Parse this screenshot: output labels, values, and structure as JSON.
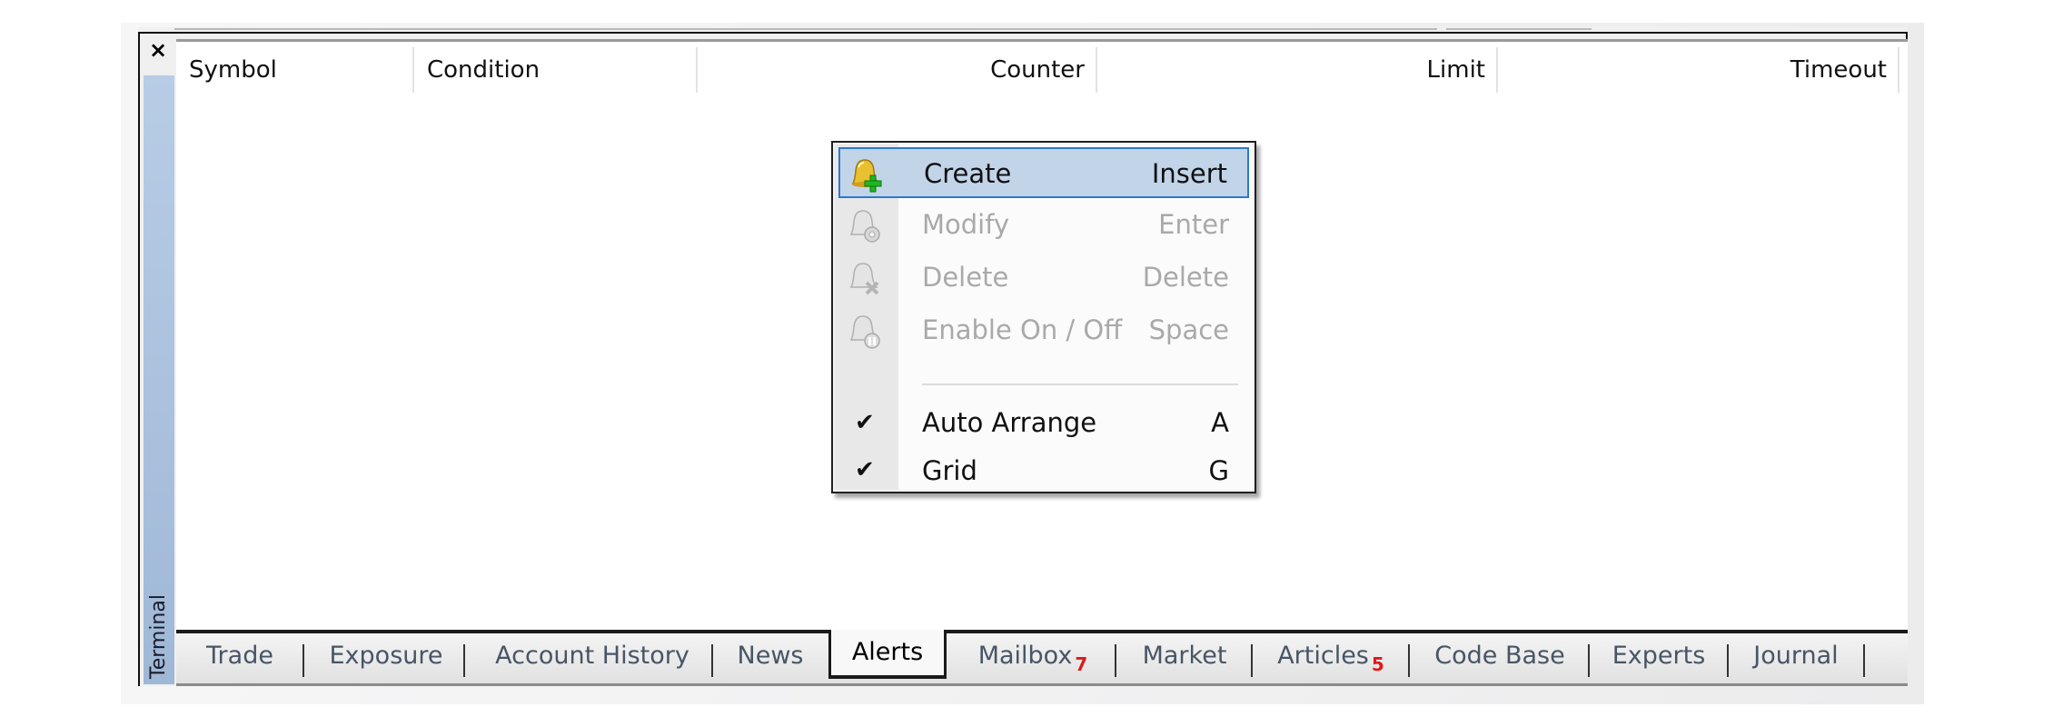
{
  "panel": {
    "title": "Terminal",
    "close_label": "×"
  },
  "columns": [
    {
      "label": "Symbol",
      "align": "left"
    },
    {
      "label": "Condition",
      "align": "left"
    },
    {
      "label": "Counter",
      "align": "right"
    },
    {
      "label": "Limit",
      "align": "right"
    },
    {
      "label": "Timeout",
      "align": "right"
    }
  ],
  "context_menu": {
    "items": [
      {
        "label": "Create",
        "shortcut": "Insert",
        "icon": "bell-add-icon",
        "enabled": true,
        "highlighted": true
      },
      {
        "label": "Modify",
        "shortcut": "Enter",
        "icon": "bell-gear-icon",
        "enabled": false
      },
      {
        "label": "Delete",
        "shortcut": "Delete",
        "icon": "bell-delete-icon",
        "enabled": false
      },
      {
        "label": "Enable On / Off",
        "shortcut": "Space",
        "icon": "bell-pause-icon",
        "enabled": false
      },
      {
        "label": "Auto Arrange",
        "shortcut": "A",
        "checked": true,
        "enabled": true
      },
      {
        "label": "Grid",
        "shortcut": "G",
        "checked": true,
        "enabled": true
      }
    ],
    "check_glyph": "✔"
  },
  "tabs": [
    {
      "label": "Trade"
    },
    {
      "label": "Exposure"
    },
    {
      "label": "Account History"
    },
    {
      "label": "News"
    },
    {
      "label": "Alerts",
      "active": true
    },
    {
      "label": "Mailbox",
      "badge": "7"
    },
    {
      "label": "Market"
    },
    {
      "label": "Articles",
      "badge": "5"
    },
    {
      "label": "Code Base"
    },
    {
      "label": "Experts"
    },
    {
      "label": "Journal"
    }
  ],
  "colors": {
    "highlight_bg": "#c2d5e8",
    "highlight_border": "#2d78d0",
    "badge": "#e01818",
    "side_tab": "#b7cde6"
  }
}
